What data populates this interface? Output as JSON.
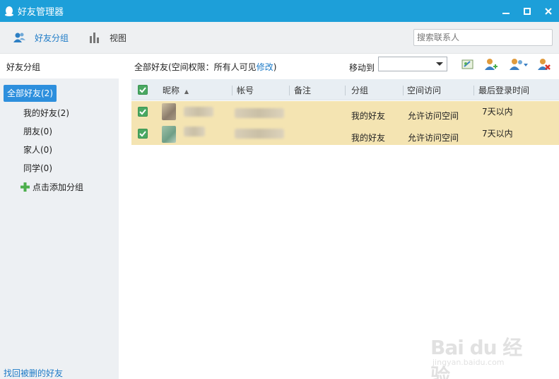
{
  "window": {
    "title": "好友管理器",
    "accent_color": "#1d9fd9",
    "controls": [
      "minimize-icon",
      "maximize-icon",
      "close-icon"
    ]
  },
  "toolbar": {
    "friend_groups_label": "好友分组",
    "view_label": "视图",
    "search_placeholder": "搜索联系人"
  },
  "sidebar": {
    "heading": "好友分组",
    "groups": [
      {
        "label": "全部好友(2)",
        "selected": true
      },
      {
        "label": "我的好友(2)"
      },
      {
        "label": "朋友(0)"
      },
      {
        "label": "家人(0)"
      },
      {
        "label": "同学(0)"
      }
    ],
    "add_group_label": "点击添加分组",
    "restore_link": "找回被删的好友"
  },
  "main": {
    "permission_text": "全部好友(空间权限：所有人可见",
    "permission_edit": "修改",
    "permission_close": ")",
    "move_to_label": "移动到",
    "move_to_value": "",
    "action_icons": [
      "edit-remark-icon",
      "add-friend-icon",
      "friend-options-icon",
      "delete-friend-icon"
    ],
    "columns": [
      "昵称",
      "帐号",
      "备注",
      "分组",
      "空间访问",
      "最后登录时间"
    ],
    "sort_indicator": "▲",
    "rows": [
      {
        "checked": true,
        "nickname": "",
        "account": "",
        "remark": "",
        "group": "我的好友",
        "space_access": "允许访问空间",
        "last_login": "7天以内"
      },
      {
        "checked": true,
        "nickname": "",
        "account": "",
        "remark": "",
        "group": "我的好友",
        "space_access": "允许访问空间",
        "last_login": "7天以内"
      }
    ],
    "row_highlight_color": "#f4e4b2"
  },
  "watermark": {
    "text": "Bai du 经验",
    "url": "jingyan.baidu.com"
  }
}
